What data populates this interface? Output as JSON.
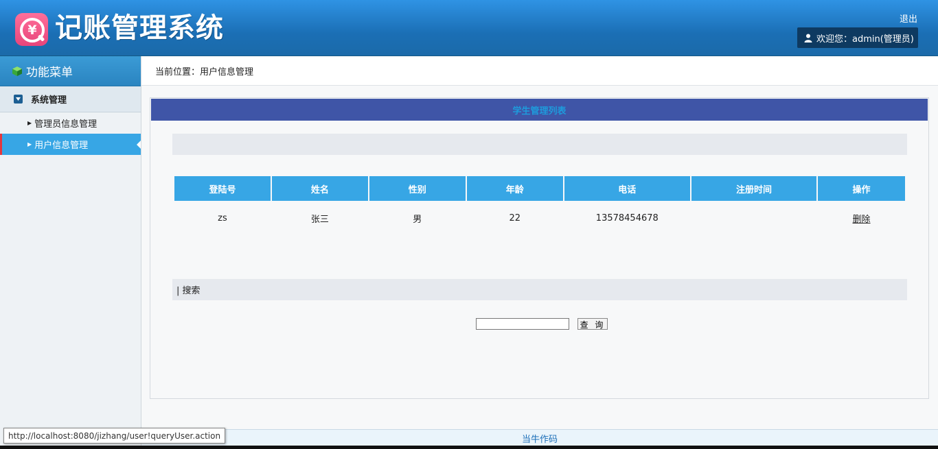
{
  "header": {
    "title": "记账管理系统",
    "logo_glyph": "¥",
    "logout_label": "退出",
    "welcome_text": "欢迎您：admin(管理员)"
  },
  "sidebar": {
    "menu_title": "功能菜单",
    "group_title": "系统管理",
    "items": [
      {
        "label": "管理员信息管理"
      },
      {
        "label": "用户信息管理"
      }
    ]
  },
  "breadcrumb": "当前位置：用户信息管理",
  "panel": {
    "title": "学生管理列表",
    "search_section_label": "| 搜索",
    "search_input_value": "",
    "search_button_label": "查 询"
  },
  "table": {
    "headers": [
      "登陆号",
      "姓名",
      "性别",
      "年龄",
      "电话",
      "注册时间",
      "操作"
    ],
    "rows": [
      {
        "login": "zs",
        "name": "张三",
        "gender": "男",
        "age": "22",
        "phone": "13578454678",
        "reg_time": "",
        "action": "删除"
      }
    ]
  },
  "footer": {
    "text": "当牛作码"
  },
  "status_bar": {
    "url": "http://localhost:8080/jizhang/user!queryUser.action"
  },
  "colors": {
    "header_blue": "#1b6fb5",
    "table_header": "#37a6e5",
    "panel_title_bg": "#3f55a7",
    "active_marker": "#e3373f"
  }
}
